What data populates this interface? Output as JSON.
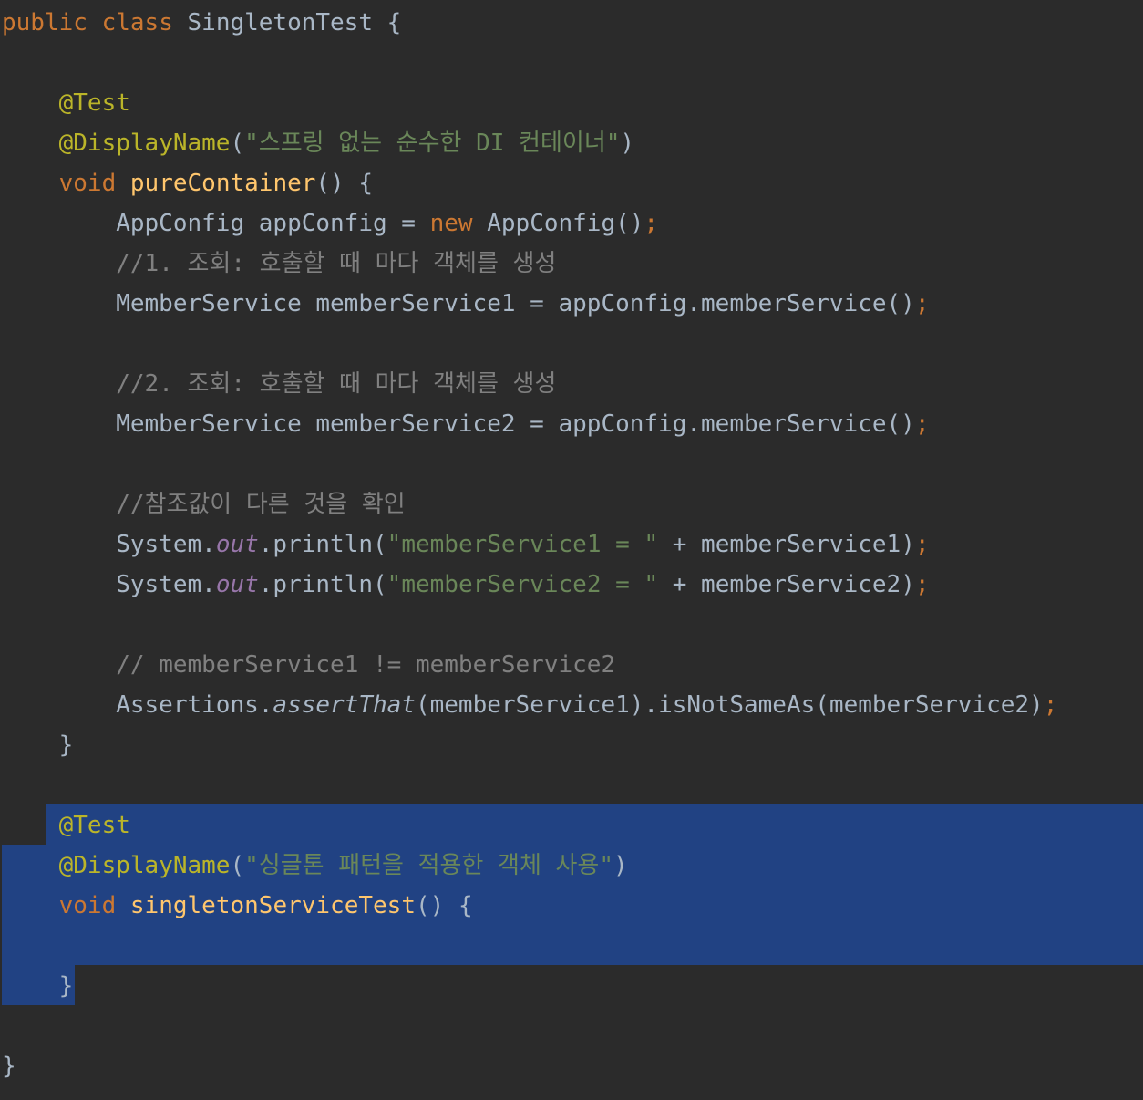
{
  "editor": {
    "lines": [
      [
        {
          "t": "public",
          "c": "kw"
        },
        {
          "t": " "
        },
        {
          "t": "class",
          "c": "kw"
        },
        {
          "t": " SingletonTest {"
        }
      ],
      [],
      [
        {
          "t": "    "
        },
        {
          "t": "@Test",
          "c": "ann"
        }
      ],
      [
        {
          "t": "    "
        },
        {
          "t": "@DisplayName",
          "c": "ann"
        },
        {
          "t": "("
        },
        {
          "t": "\"스프링 없는 순수한 DI 컨테이너\"",
          "c": "str"
        },
        {
          "t": ")"
        }
      ],
      [
        {
          "t": "    "
        },
        {
          "t": "void",
          "c": "kw"
        },
        {
          "t": " "
        },
        {
          "t": "pureContainer",
          "c": "fn"
        },
        {
          "t": "() {"
        }
      ],
      [
        {
          "t": "        AppConfig appConfig = "
        },
        {
          "t": "new",
          "c": "kw"
        },
        {
          "t": " AppConfig()"
        },
        {
          "t": ";",
          "c": "kw"
        }
      ],
      [
        {
          "t": "        "
        },
        {
          "t": "//1. 조회: 호출할 때 마다 객체를 생성",
          "c": "cm"
        }
      ],
      [
        {
          "t": "        MemberService memberService1 = appConfig.memberService()"
        },
        {
          "t": ";",
          "c": "kw"
        }
      ],
      [],
      [
        {
          "t": "        "
        },
        {
          "t": "//2. 조회: 호출할 때 마다 객체를 생성",
          "c": "cm"
        }
      ],
      [
        {
          "t": "        MemberService memberService2 = appConfig.memberService()"
        },
        {
          "t": ";",
          "c": "kw"
        }
      ],
      [],
      [
        {
          "t": "        "
        },
        {
          "t": "//참조값이 다른 것을 확인",
          "c": "cm"
        }
      ],
      [
        {
          "t": "        System."
        },
        {
          "t": "out",
          "c": "sf"
        },
        {
          "t": ".println("
        },
        {
          "t": "\"memberService1 = \"",
          "c": "str"
        },
        {
          "t": " + memberService1)"
        },
        {
          "t": ";",
          "c": "kw"
        }
      ],
      [
        {
          "t": "        System."
        },
        {
          "t": "out",
          "c": "sf"
        },
        {
          "t": ".println("
        },
        {
          "t": "\"memberService2 = \"",
          "c": "str"
        },
        {
          "t": " + memberService2)"
        },
        {
          "t": ";",
          "c": "kw"
        }
      ],
      [],
      [
        {
          "t": "        "
        },
        {
          "t": "// memberService1 != memberService2",
          "c": "cm"
        }
      ],
      [
        {
          "t": "        Assertions."
        },
        {
          "t": "assertThat",
          "c": "st"
        },
        {
          "t": "(memberService1).isNotSameAs(memberService2)"
        },
        {
          "t": ";",
          "c": "kw"
        }
      ],
      [
        {
          "t": "    }"
        }
      ],
      [],
      [
        {
          "t": "    "
        },
        {
          "t": "@Test",
          "c": "ann"
        }
      ],
      [
        {
          "t": "    "
        },
        {
          "t": "@DisplayName",
          "c": "ann"
        },
        {
          "t": "("
        },
        {
          "t": "\"싱글톤 패턴을 적용한 객체 사용\"",
          "c": "str"
        },
        {
          "t": ")"
        }
      ],
      [
        {
          "t": "    "
        },
        {
          "t": "void",
          "c": "kw"
        },
        {
          "t": " "
        },
        {
          "t": "singletonServiceTest",
          "c": "fn"
        },
        {
          "t": "() {"
        }
      ],
      [],
      [
        {
          "t": "    }"
        }
      ],
      [],
      [
        {
          "t": "}"
        }
      ]
    ]
  }
}
